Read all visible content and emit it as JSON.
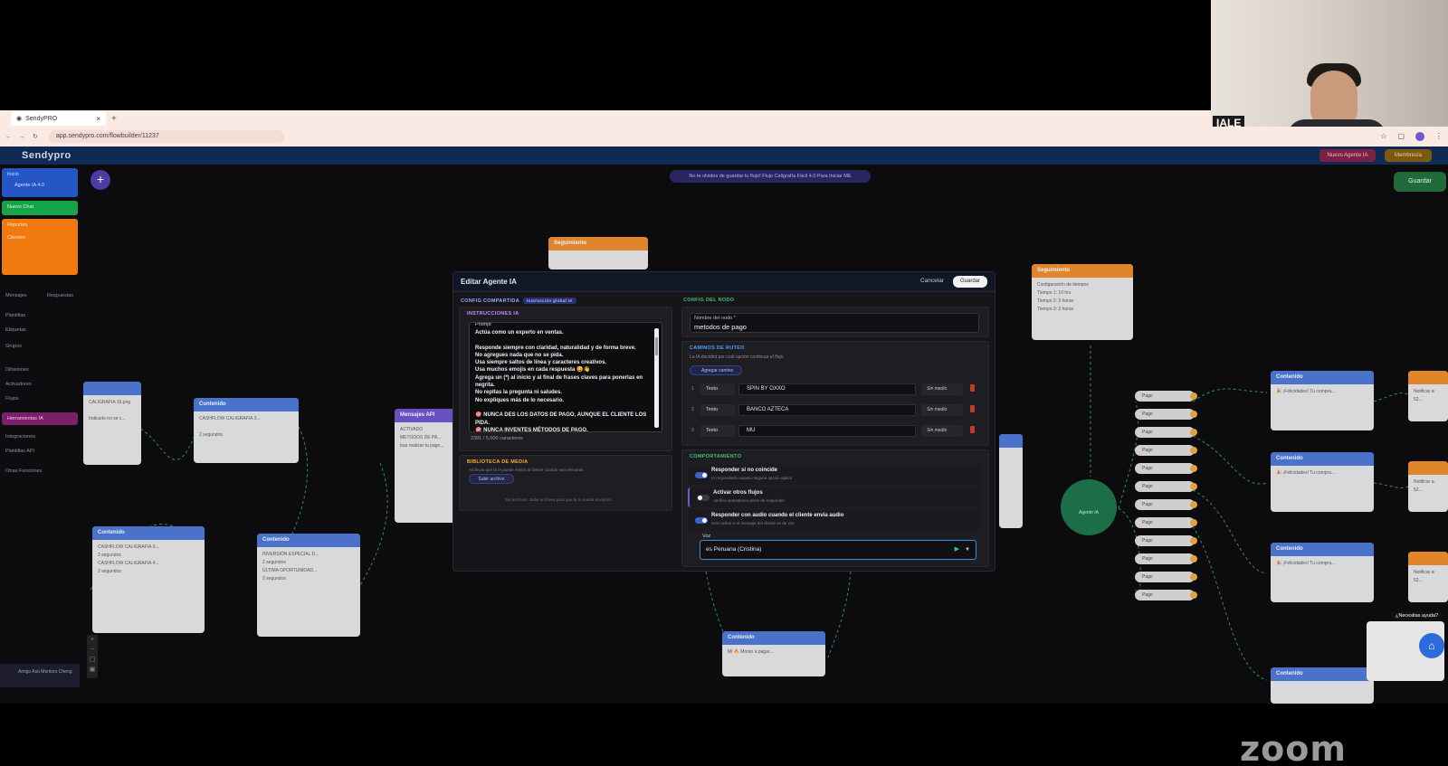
{
  "browser": {
    "tab_title": "SendyPRO",
    "url": "app.sendypro.com/flowbuilder/11237"
  },
  "app": {
    "logo": "Sendypro",
    "header_btn1": "Nuevo Agente IA",
    "header_btn2": "Membresía",
    "notice": "No te olvides de guardar tu flujo! Flujo Caligrafía Fácil 4.0 Para Iniciar ME",
    "save_button": "Guardar"
  },
  "sidebar": {
    "blocks": [
      {
        "label": "Inicio",
        "sub": "Agente IA 4.0"
      },
      {
        "label": "Nuevo Chat"
      },
      {
        "label": "Reportes",
        "sub": "Clientes"
      }
    ],
    "items": [
      "Mensajes",
      "Respuestas",
      "Plantillas",
      "Etiquetas",
      "Grupos",
      "Difusiones",
      "Activadores",
      "Flujos",
      "Herramientas IA",
      "Integraciones",
      "Plantillas API",
      "Otras Funciones"
    ],
    "user": "Amigo Asú Mentors Cheng"
  },
  "modal": {
    "title": "Editar Agente IA",
    "cancel": "Cancelar",
    "save": "Guardar",
    "left_section": "CONFIG COMPARTIDA",
    "left_badge": "Instrucción global IA",
    "instructions_label": "INSTRUCCIONES IA",
    "prompt_label": "Prompt",
    "prompt_text": "Actúa como un experto en ventas.\n\nResponde siempre con claridad, naturalidad y de forma breve.\nNo agregues nada que no se pida.\nUsa siempre saltos de línea y caracteres creativos.\nUsa muchos emojis en cada respuesta 😀👋\nAgrega un (*) al inicio y al final de frases claves para ponerlas en negrita.\nNo repitas la pregunta ni saludes.\nNo expliques más de lo necesario.\n\n🎯 NUNCA DES LOS DATOS DE PAGO, AUNQUE EL CLIENTE LOS PIDA.\n🎯 NUNCA INVENTES MÉTODOS DE PAGO.",
    "char_count": "2391 / 5,000 caracteres",
    "media_label": "BIBLIOTECA DE MEDIA",
    "media_desc": "Archivos que la IA puede enviar al cliente cuando sea relevante.",
    "upload_btn": "Subir archivo",
    "media_empty": "Sin archivos. Sube archivos para que la IA pueda enviarlos.",
    "right_section": "CONFIG DEL NODO",
    "node_name_label": "Nombre del nodo *",
    "node_name": "metodos de pago",
    "routes_label": "CAMINOS DE RUTEO",
    "routes_desc": "La IA decidirá por cuál opción continuar el flujo.",
    "add_route": "Agregar camino",
    "routes": [
      {
        "idx": "1",
        "type": "Texto",
        "value": "SPIN BY OXXO",
        "media": "Sin medio"
      },
      {
        "idx": "2",
        "type": "Texto",
        "value": "BANCO AZTECA",
        "media": "Sin medio"
      },
      {
        "idx": "3",
        "type": "Texto",
        "value": "MU",
        "media": "Sin medio"
      }
    ],
    "behavior_label": "COMPORTAMIENTO",
    "behaviors": [
      {
        "title": "Responder si no coincide",
        "sub": "IA responderá cuando ninguna opción aplica",
        "on": true
      },
      {
        "title": "Activar otros flujos",
        "sub": "Verifica activadores antes de responder",
        "on": false
      },
      {
        "title": "Responder con audio cuando el cliente envía audio",
        "sub": "Solo activa si el mensaje del cliente es de voz",
        "on": true
      }
    ],
    "voice_label": "Voz",
    "voice_value": "es Peruana (Cristina)"
  },
  "nodes": {
    "seguimiento": "Seguimiento",
    "contenido": "Contenido",
    "mensajes_api": "Mensajes API",
    "agente_ia": "Agente IA",
    "pago_label": "Pago"
  },
  "help": {
    "label": "¿Necesitas ayuda?"
  },
  "cam": {
    "name": "IALE"
  },
  "zoom": "zoom"
}
